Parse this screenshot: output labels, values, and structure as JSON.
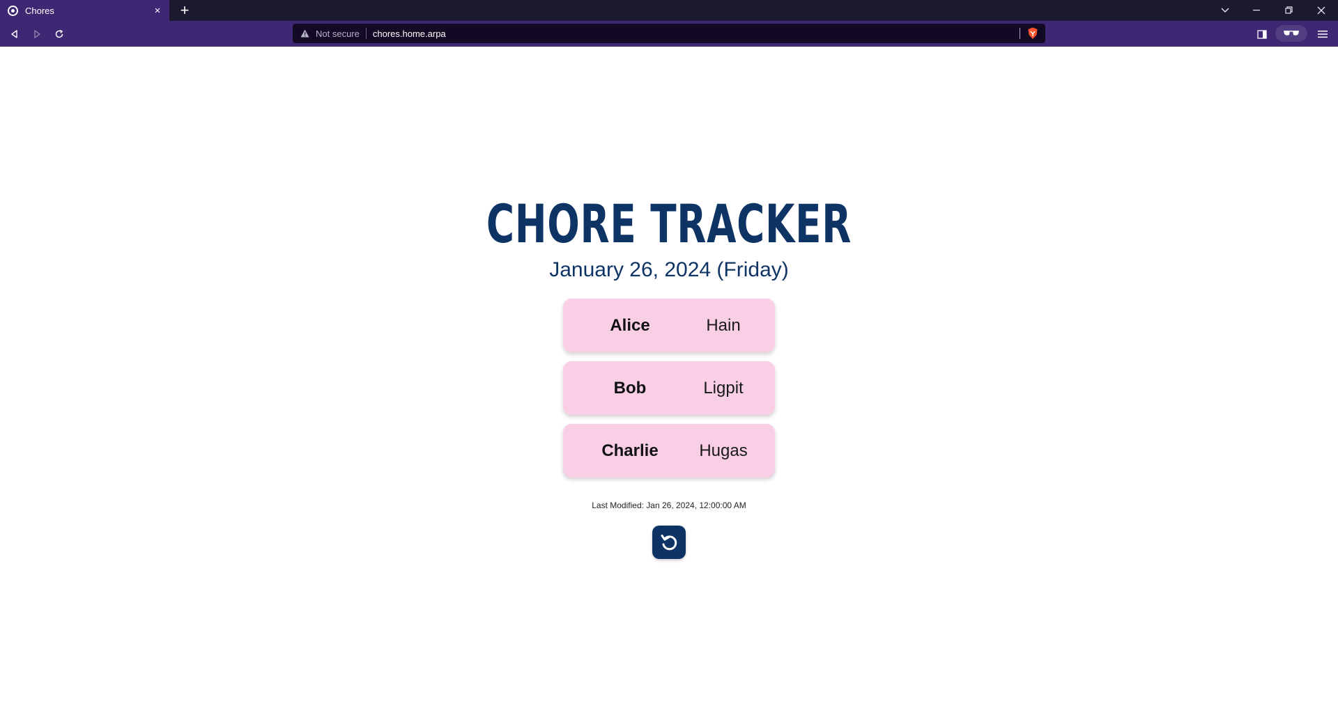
{
  "browser": {
    "tab": {
      "title": "Chores",
      "close_label": "×"
    },
    "new_tab_label": "+",
    "address": {
      "security_label": "Not secure",
      "url": "chores.home.arpa"
    }
  },
  "app": {
    "title": "CHORE TRACKER",
    "date": "January 26, 2024 (Friday)",
    "chores": [
      {
        "name": "Alice",
        "task": "Hain"
      },
      {
        "name": "Bob",
        "task": "Ligpit"
      },
      {
        "name": "Charlie",
        "task": "Hugas"
      }
    ],
    "last_modified": "Last Modified: Jan 26, 2024, 12:00:00 AM"
  },
  "colors": {
    "accent": "#0d3464",
    "card": "#f9cfe6",
    "chrome": "#3e2874"
  }
}
